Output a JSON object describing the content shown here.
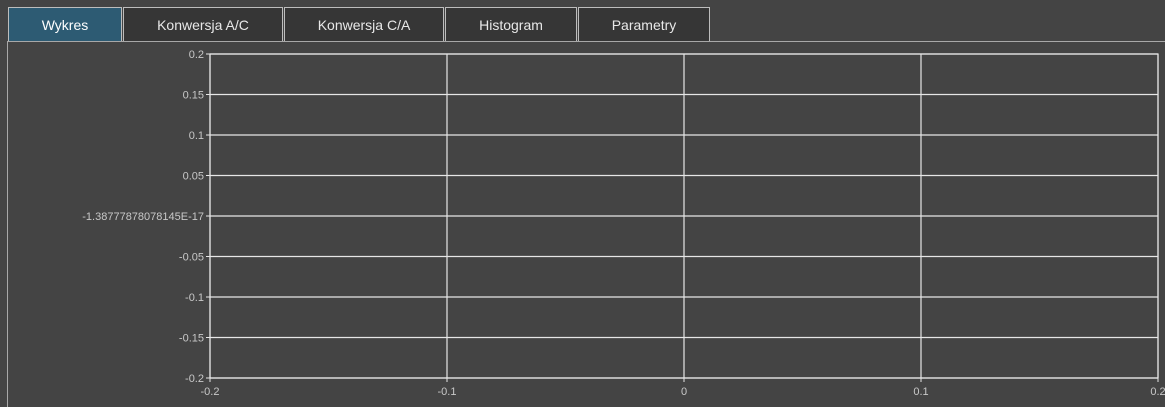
{
  "tabs": [
    {
      "label": "Wykres",
      "active": true
    },
    {
      "label": "Konwersja A/C",
      "active": false
    },
    {
      "label": "Konwersja C/A",
      "active": false
    },
    {
      "label": "Histogram",
      "active": false
    },
    {
      "label": "Parametry",
      "active": false
    }
  ],
  "colors": {
    "background": "#444444",
    "active_tab": "#2d5b73",
    "inactive_tab": "#363636",
    "grid": "#e6e6e6",
    "text": "#c8c8c8"
  },
  "chart_data": {
    "type": "line",
    "series": [],
    "xlim": [
      -0.2,
      0.2
    ],
    "ylim": [
      -0.2,
      0.2
    ],
    "grid": true,
    "x_ticks": [
      -0.2,
      -0.1,
      0,
      0.1,
      0.2
    ],
    "x_tick_labels": [
      "-0.2",
      "-0.1",
      "0",
      "0.1",
      "0.2"
    ],
    "y_ticks": [
      0.2,
      0.15,
      0.1,
      0.05,
      0,
      -0.05,
      -0.1,
      -0.15,
      -0.2
    ],
    "y_tick_labels": [
      "0.2",
      "0.15",
      "0.1",
      "0.05",
      "-1.38777878078145E-17",
      "-0.05",
      "-0.1",
      "-0.15",
      "-0.2"
    ]
  }
}
